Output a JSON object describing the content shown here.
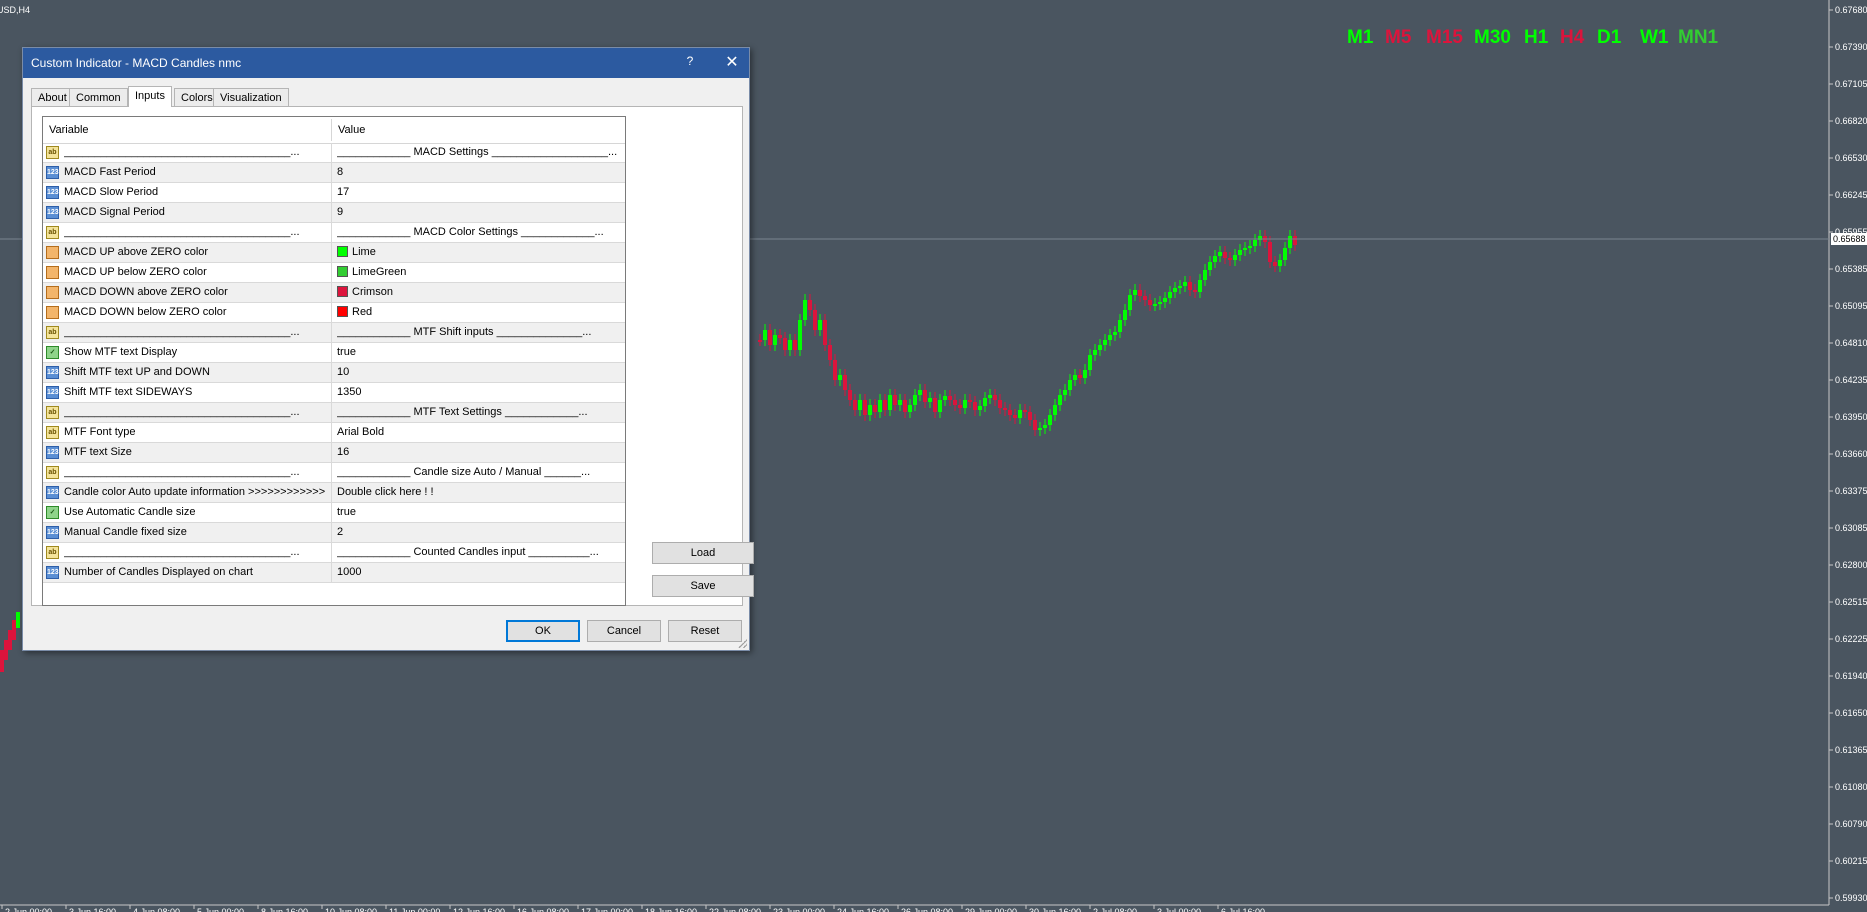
{
  "chart": {
    "symbol": "USD,H4",
    "background": "#4a5560",
    "bull_color": "#00ff00",
    "bear_color": "#dc143c",
    "price_labels": [
      "0.67680",
      "0.67390",
      "0.67105",
      "0.66820",
      "0.66530",
      "0.66245",
      "0.65955",
      "0.65385",
      "0.65095",
      "0.64810",
      "0.64235",
      "0.63950",
      "0.63660",
      "0.63375",
      "0.63085",
      "0.62800",
      "0.62515",
      "0.62225",
      "0.61940",
      "0.61650",
      "0.61365",
      "0.61080",
      "0.60790",
      "0.60215",
      "0.59930"
    ],
    "current_price": "0.65688",
    "time_labels": [
      "2 Jun 00:00",
      "3 Jun 16:00",
      "4 Jun 08:00",
      "5 Jun 00:00",
      "8 Jun 16:00",
      "10 Jun 08:00",
      "11 Jun 00:00",
      "12 Jun 16:00",
      "16 Jun 08:00",
      "17 Jun 00:00",
      "18 Jun 16:00",
      "22 Jun 08:00",
      "23 Jun 00:00",
      "24 Jun 16:00",
      "26 Jun 08:00",
      "29 Jun 00:00",
      "30 Jun 16:00",
      "2 Jul 08:00",
      "3 Jul 00:00",
      "6 Jul 16:00"
    ],
    "timeframes": [
      {
        "label": "M1",
        "color": "#00ff00"
      },
      {
        "label": "M5",
        "color": "#dc143c"
      },
      {
        "label": "M15",
        "color": "#dc143c"
      },
      {
        "label": "M30",
        "color": "#00ff00"
      },
      {
        "label": "H1",
        "color": "#00ff00"
      },
      {
        "label": "H4",
        "color": "#dc143c"
      },
      {
        "label": "D1",
        "color": "#00ff00"
      },
      {
        "label": "W1",
        "color": "#00ff00"
      },
      {
        "label": "MN1",
        "color": "#32cd32"
      }
    ]
  },
  "dialog": {
    "title": "Custom Indicator - MACD Candles nmc",
    "help_label": "?",
    "close_label": "✕",
    "tabs": [
      "About",
      "Common",
      "Inputs",
      "Colors",
      "Visualization"
    ],
    "active_tab": "Inputs",
    "columns": {
      "variable": "Variable",
      "value": "Value"
    },
    "rows": [
      {
        "icon": "ab",
        "var": "_____________________________________...",
        "val": "____________ MACD Settings ___________________..."
      },
      {
        "icon": "123",
        "var": "MACD Fast Period",
        "val": "8"
      },
      {
        "icon": "123",
        "var": "MACD Slow Period",
        "val": "17"
      },
      {
        "icon": "123",
        "var": "MACD Signal Period",
        "val": "9"
      },
      {
        "icon": "ab",
        "var": "_____________________________________...",
        "val": "____________ MACD Color Settings ____________..."
      },
      {
        "icon": "color",
        "var": "MACD UP above ZERO color",
        "val": "Lime",
        "swatch": "#00ff00"
      },
      {
        "icon": "color",
        "var": "MACD UP below ZERO color",
        "val": "LimeGreen",
        "swatch": "#32cd32"
      },
      {
        "icon": "color",
        "var": "MACD DOWN above ZERO color",
        "val": "Crimson",
        "swatch": "#dc143c"
      },
      {
        "icon": "color",
        "var": "MACD DOWN below ZERO color",
        "val": "Red",
        "swatch": "#ff0000"
      },
      {
        "icon": "ab",
        "var": "_____________________________________...",
        "val": "____________ MTF Shift inputs ______________..."
      },
      {
        "icon": "bool",
        "var": "Show MTF text Display",
        "val": "true"
      },
      {
        "icon": "123",
        "var": "Shift MTF text UP and DOWN",
        "val": "10"
      },
      {
        "icon": "123",
        "var": "Shift MTF text SIDEWAYS",
        "val": "1350"
      },
      {
        "icon": "ab",
        "var": "_____________________________________...",
        "val": "____________ MTF Text Settings ____________..."
      },
      {
        "icon": "ab",
        "var": "MTF Font type",
        "val": "Arial Bold"
      },
      {
        "icon": "123",
        "var": "MTF text Size",
        "val": "16"
      },
      {
        "icon": "ab",
        "var": "_____________________________________...",
        "val": "____________ Candle size Auto / Manual ______..."
      },
      {
        "icon": "123",
        "var": "Candle color Auto update information >>>>>>>>>>>>...",
        "val": "Double click here ! !"
      },
      {
        "icon": "bool",
        "var": "Use Automatic Candle size",
        "val": "true"
      },
      {
        "icon": "123",
        "var": "Manual Candle fixed size",
        "val": "2"
      },
      {
        "icon": "ab",
        "var": "_____________________________________...",
        "val": "____________ Counted Candles input __________..."
      },
      {
        "icon": "123",
        "var": "Number of Candles Displayed on chart",
        "val": "1000"
      }
    ],
    "buttons": {
      "load": "Load",
      "save": "Save",
      "ok": "OK",
      "cancel": "Cancel",
      "reset": "Reset"
    }
  }
}
